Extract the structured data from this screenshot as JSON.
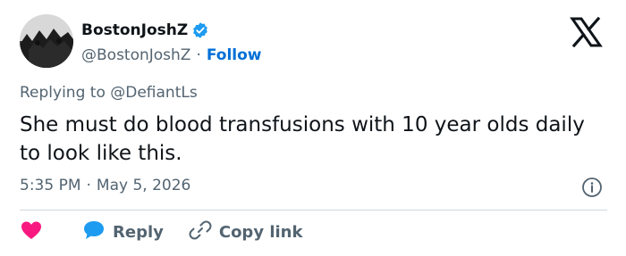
{
  "author": {
    "display_name": "BostonJoshZ",
    "handle": "@BostonJoshZ",
    "separator": "·",
    "follow_label": "Follow",
    "verified": true
  },
  "reply_context": {
    "prefix": "Replying to",
    "mention": "@DefiantLs"
  },
  "tweet": {
    "text": "She must do blood transfusions with 10 year olds daily to look like this."
  },
  "meta": {
    "time": "5:35 PM",
    "separator": "·",
    "date": "May 5, 2026"
  },
  "actions": {
    "reply_label": "Reply",
    "copy_link_label": "Copy link"
  },
  "colors": {
    "accent": "#006fd6",
    "verified": "#1d9bf0",
    "like": "#f91880",
    "text_secondary": "#536471"
  },
  "icons": [
    "avatar",
    "verified-badge-icon",
    "x-logo-icon",
    "info-icon",
    "heart-icon",
    "reply-bubble-icon",
    "link-icon"
  ]
}
